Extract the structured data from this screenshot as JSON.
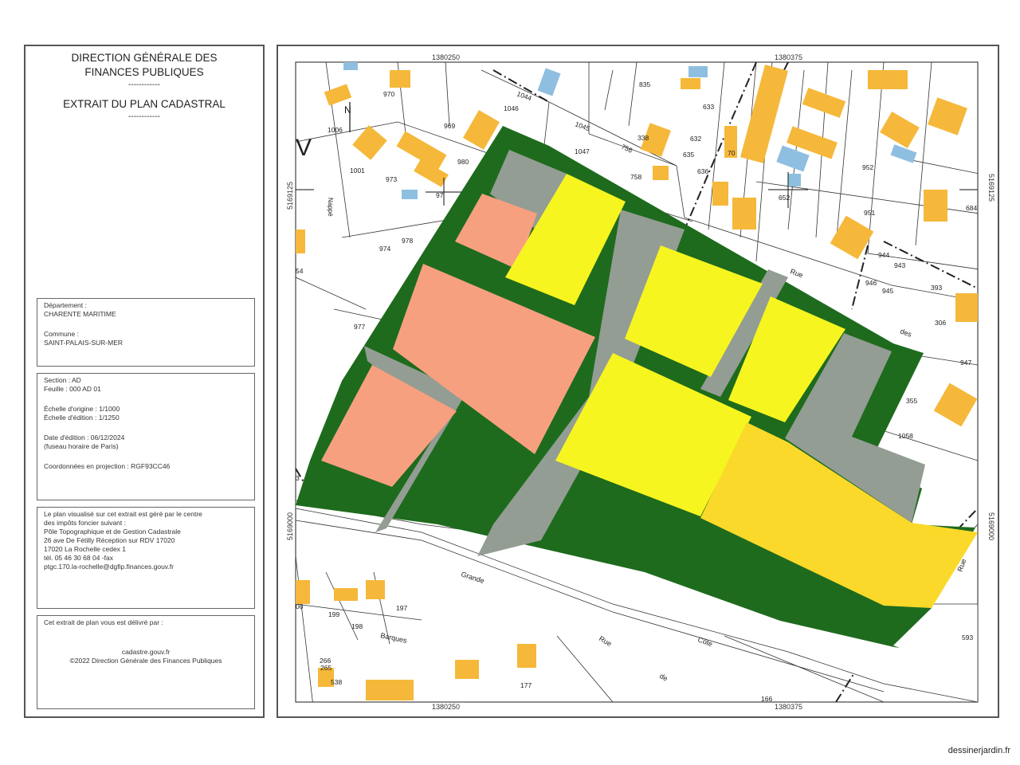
{
  "header": {
    "title_line1": "DIRECTION GÉNÉRALE DES",
    "title_line2": "FINANCES PUBLIQUES",
    "separator": "------------",
    "subtitle": "EXTRAIT DU PLAN CADASTRAL"
  },
  "location": {
    "department_label": "Département :",
    "department_value": "CHARENTE MARITIME",
    "commune_label": "Commune :",
    "commune_value": "SAINT-PALAIS-SUR-MER"
  },
  "section_info": {
    "section": "Section : AD",
    "feuille": "Feuille : 000 AD 01",
    "echelle_origine": "Échelle d'origine : 1/1000",
    "echelle_edition": "Échelle d'édition : 1/1250",
    "date_edition": "Date d'édition : 06/12/2024",
    "fuseau": "(fuseau horaire de Paris)",
    "coordonnees": "Coordonnées en projection : RGF93CC46"
  },
  "centre_info": {
    "line1": "Le plan visualisé sur cet extrait est géré par le centre",
    "line2": "des impôts foncier suivant :",
    "line3": "Pôle Topographique et de Gestion Cadastrale",
    "line4": "26 ave De Fétilly Réception sur RDV 17020",
    "line5": "17020 La Rochelle cedex 1",
    "line6": "tél. 05 46 30 68 04 -fax",
    "line7": "ptgc.170.la-rochelle@dgfip.finances.gouv.fr"
  },
  "delivery": {
    "line1": "Cet extrait de plan vous est délivré par :",
    "line2": "cadastre.gouv.fr",
    "line3": "©2022 Direction Générale des Finances Publiques"
  },
  "map": {
    "grid_labels": {
      "top_left": "1380250",
      "top_right": "1380375",
      "bottom_left": "1380250",
      "bottom_right": "1380375",
      "left_top": "5169125",
      "left_bottom": "5169000",
      "right_top": "5169125",
      "right_bottom": "5169000"
    },
    "north": "N",
    "parcels": [
      "970",
      "1046",
      "1044",
      "835",
      "633",
      "1006",
      "969",
      "1045",
      "338",
      "632",
      "635",
      "636",
      "756",
      "1047",
      "758",
      "1001",
      "973",
      "980",
      "97",
      "652",
      "952",
      "951",
      "684",
      "974",
      "978",
      "944",
      "943",
      "946",
      "945",
      "393",
      "306",
      "977",
      "947",
      "355",
      "1058",
      "199",
      "198",
      "197",
      "177",
      "593",
      "265",
      "266",
      "538",
      "166",
      "70",
      "54",
      "00",
      "3"
    ],
    "street_labels": [
      "Rue",
      "des",
      "Grande",
      "Barques",
      "Rue",
      "de",
      "Côte",
      "Rue"
    ],
    "colors": {
      "dark_green": "#1e6b1e",
      "gray": "#939d93",
      "salmon": "#f7a080",
      "yellow": "#f7f520",
      "gold": "#fbd92b",
      "building": "#f5b83a",
      "water": "#8fbfe0"
    }
  },
  "footer": {
    "credit": "dessinerjardin.fr"
  }
}
